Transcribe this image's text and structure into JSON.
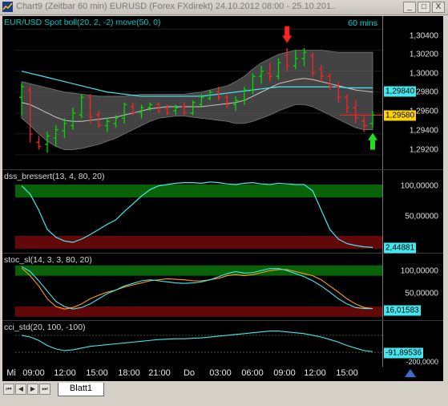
{
  "window": {
    "title": "Chart9 (Zeitbar 60 min)  EURUSD (Forex FXdirekt) 24.10.2012 08:00 - 25.10.201...",
    "buttons": [
      "_",
      "□",
      "X"
    ]
  },
  "price_pane": {
    "label": "EUR/USD Spot boll(20, 2, -2) move(50, 0)",
    "timeframe": "60 mins",
    "ticks": [
      "1,30400",
      "1,30200",
      "1,30000",
      "1,29800",
      "1,29600",
      "1,29400",
      "1,29200"
    ],
    "value_boxes": [
      "1,29840",
      "1,29580"
    ]
  },
  "dss_pane": {
    "label": "dss_bressert(13, 4, 80, 20)",
    "ticks": [
      "100,00000",
      "50,00000"
    ],
    "value_box": "2,44881"
  },
  "stoc_pane": {
    "label": "stoc_sl(14, 3, 3, 80, 20)",
    "ticks": [
      "100,00000",
      "50,00000"
    ],
    "value_box": "16,01583"
  },
  "cci_pane": {
    "label": "cci_std(20, 100, -100)",
    "value_box": "-91,89536",
    "tick": "-200,0000"
  },
  "time_axis": {
    "labels": [
      "Mi",
      "09:00",
      "12:00",
      "15:00",
      "18:00",
      "21:00",
      "Do",
      "03:00",
      "06:00",
      "09:00",
      "12:00",
      "15:00"
    ]
  },
  "tabs": {
    "sheet": "Blatt1",
    "nav": [
      "⏮",
      "◀",
      "▶",
      "⏭"
    ]
  },
  "colors": {
    "up": "#00dd00",
    "down": "#ff2020",
    "band": "#5a5a5a",
    "cyan": "#44e8f0",
    "ma": "#c8c8c8",
    "green_zone": "#0a7a0a",
    "red_zone": "#7a0a0a"
  },
  "chart_data": {
    "type": "candlestick",
    "price": {
      "ylim": [
        1.291,
        1.3045
      ],
      "candles": [
        {
          "o": 1.2975,
          "h": 1.2988,
          "l": 1.2958,
          "c": 1.2985
        },
        {
          "o": 1.2982,
          "h": 1.2985,
          "l": 1.2932,
          "c": 1.294
        },
        {
          "o": 1.2932,
          "h": 1.2938,
          "l": 1.2925,
          "c": 1.2928
        },
        {
          "o": 1.293,
          "h": 1.2942,
          "l": 1.2922,
          "c": 1.2938
        },
        {
          "o": 1.2936,
          "h": 1.2948,
          "l": 1.2928,
          "c": 1.2944
        },
        {
          "o": 1.2943,
          "h": 1.2955,
          "l": 1.2936,
          "c": 1.295
        },
        {
          "o": 1.2948,
          "h": 1.2965,
          "l": 1.2944,
          "c": 1.296
        },
        {
          "o": 1.2958,
          "h": 1.2978,
          "l": 1.2955,
          "c": 1.2975
        },
        {
          "o": 1.2975,
          "h": 1.2978,
          "l": 1.295,
          "c": 1.2956
        },
        {
          "o": 1.2958,
          "h": 1.2962,
          "l": 1.2946,
          "c": 1.2948
        },
        {
          "o": 1.2948,
          "h": 1.2956,
          "l": 1.2942,
          "c": 1.2952
        },
        {
          "o": 1.295,
          "h": 1.2958,
          "l": 1.2946,
          "c": 1.2955
        },
        {
          "o": 1.2955,
          "h": 1.297,
          "l": 1.295,
          "c": 1.2968
        },
        {
          "o": 1.2966,
          "h": 1.297,
          "l": 1.2958,
          "c": 1.296
        },
        {
          "o": 1.296,
          "h": 1.2968,
          "l": 1.2955,
          "c": 1.2965
        },
        {
          "o": 1.2965,
          "h": 1.297,
          "l": 1.2962,
          "c": 1.2968
        },
        {
          "o": 1.2968,
          "h": 1.297,
          "l": 1.296,
          "c": 1.2962
        },
        {
          "o": 1.2964,
          "h": 1.2968,
          "l": 1.2958,
          "c": 1.296
        },
        {
          "o": 1.2962,
          "h": 1.2968,
          "l": 1.2958,
          "c": 1.2965
        },
        {
          "o": 1.2966,
          "h": 1.297,
          "l": 1.2958,
          "c": 1.296
        },
        {
          "o": 1.296,
          "h": 1.2972,
          "l": 1.2958,
          "c": 1.297
        },
        {
          "o": 1.2968,
          "h": 1.2978,
          "l": 1.2966,
          "c": 1.2975
        },
        {
          "o": 1.2974,
          "h": 1.2982,
          "l": 1.2972,
          "c": 1.298
        },
        {
          "o": 1.298,
          "h": 1.2985,
          "l": 1.2972,
          "c": 1.2975
        },
        {
          "o": 1.2975,
          "h": 1.2978,
          "l": 1.2965,
          "c": 1.2968
        },
        {
          "o": 1.2968,
          "h": 1.2976,
          "l": 1.2962,
          "c": 1.2972
        },
        {
          "o": 1.2972,
          "h": 1.2985,
          "l": 1.2968,
          "c": 1.2982
        },
        {
          "o": 1.2982,
          "h": 1.2998,
          "l": 1.2978,
          "c": 1.2995
        },
        {
          "o": 1.2995,
          "h": 1.3005,
          "l": 1.2988,
          "c": 1.3
        },
        {
          "o": 1.2998,
          "h": 1.3008,
          "l": 1.299,
          "c": 1.2995
        },
        {
          "o": 1.2995,
          "h": 1.3012,
          "l": 1.2992,
          "c": 1.3008
        },
        {
          "o": 1.3015,
          "h": 1.3022,
          "l": 1.3,
          "c": 1.3005
        },
        {
          "o": 1.3005,
          "h": 1.302,
          "l": 1.3002,
          "c": 1.3012
        },
        {
          "o": 1.3012,
          "h": 1.3022,
          "l": 1.3005,
          "c": 1.3018
        },
        {
          "o": 1.3015,
          "h": 1.3018,
          "l": 1.2995,
          "c": 1.2998
        },
        {
          "o": 1.3002,
          "h": 1.3006,
          "l": 1.299,
          "c": 1.2995
        },
        {
          "o": 1.2995,
          "h": 1.2998,
          "l": 1.2982,
          "c": 1.2985
        },
        {
          "o": 1.2985,
          "h": 1.299,
          "l": 1.297,
          "c": 1.2975
        },
        {
          "o": 1.2975,
          "h": 1.2978,
          "l": 1.296,
          "c": 1.2965
        },
        {
          "o": 1.2965,
          "h": 1.2972,
          "l": 1.295,
          "c": 1.2955
        },
        {
          "o": 1.2952,
          "h": 1.2958,
          "l": 1.2942,
          "c": 1.2948
        },
        {
          "o": 1.295,
          "h": 1.2962,
          "l": 1.2946,
          "c": 1.2958
        }
      ],
      "upper_band": [
        1.299,
        1.2988,
        1.2986,
        1.2984,
        1.2982,
        1.298,
        1.2979,
        1.2978,
        1.2977,
        1.2976,
        1.2976,
        1.2976,
        1.2976,
        1.2977,
        1.2978,
        1.2978,
        1.2978,
        1.2978,
        1.2978,
        1.2978,
        1.2979,
        1.298,
        1.2982,
        1.2984,
        1.2986,
        1.299,
        1.2995,
        1.3002,
        1.3008,
        1.3012,
        1.3016,
        1.3018,
        1.302,
        1.302,
        1.302,
        1.302,
        1.3019,
        1.3018,
        1.3018,
        1.3018,
        1.3018,
        1.3018
      ],
      "lower_band": [
        1.2955,
        1.2948,
        1.294,
        1.2933,
        1.2928,
        1.2925,
        1.2925,
        1.2926,
        1.2928,
        1.293,
        1.2933,
        1.2936,
        1.294,
        1.2944,
        1.2948,
        1.2952,
        1.2955,
        1.2956,
        1.2957,
        1.2957,
        1.2956,
        1.2955,
        1.2954,
        1.2953,
        1.2952,
        1.295,
        1.295,
        1.2952,
        1.2955,
        1.2958,
        1.2962,
        1.2965,
        1.2968,
        1.2968,
        1.2966,
        1.2962,
        1.2958,
        1.2954,
        1.295,
        1.2946,
        1.2944,
        1.2944
      ],
      "middle_band": [
        1.297,
        1.2968,
        1.2964,
        1.296,
        1.2956,
        1.2953,
        1.2952,
        1.2952,
        1.2953,
        1.2954,
        1.2955,
        1.2956,
        1.2958,
        1.296,
        1.2962,
        1.2964,
        1.2965,
        1.2966,
        1.2966,
        1.2966,
        1.2966,
        1.2966,
        1.2967,
        1.2968,
        1.2969,
        1.297,
        1.2972,
        1.2976,
        1.298,
        1.2984,
        1.2988,
        1.299,
        1.2992,
        1.2993,
        1.2992,
        1.299,
        1.2988,
        1.2986,
        1.2984,
        1.2982,
        1.2981,
        1.298
      ],
      "ma50": [
        1.3,
        1.2998,
        1.2996,
        1.2994,
        1.2992,
        1.299,
        1.2988,
        1.2986,
        1.2984,
        1.2982,
        1.298,
        1.2979,
        1.2978,
        1.2977,
        1.2976,
        1.2976,
        1.2976,
        1.2976,
        1.2976,
        1.2976,
        1.2976,
        1.2976,
        1.2977,
        1.2978,
        1.2979,
        1.298,
        1.2981,
        1.2982,
        1.2983,
        1.2984,
        1.2985,
        1.2985,
        1.2985,
        1.2985,
        1.2985,
        1.2985,
        1.2985,
        1.2985,
        1.2984,
        1.2984,
        1.2984,
        1.2984
      ],
      "hline": 1.2958
    },
    "dss": {
      "ylim": [
        -5,
        120
      ],
      "values": [
        98,
        85,
        60,
        30,
        18,
        12,
        10,
        15,
        22,
        30,
        38,
        45,
        58,
        70,
        82,
        92,
        98,
        100,
        102,
        103,
        103,
        102,
        104,
        103,
        101,
        100,
        102,
        103,
        101,
        100,
        102,
        101,
        100,
        100,
        90,
        60,
        30,
        15,
        8,
        5,
        3,
        2
      ],
      "zones": [
        80,
        20
      ]
    },
    "stoc": {
      "ylim": [
        -5,
        120
      ],
      "series": [
        {
          "values": [
            95,
            80,
            60,
            35,
            20,
            15,
            18,
            25,
            35,
            42,
            48,
            52,
            58,
            62,
            66,
            70,
            72,
            74,
            73,
            72,
            70,
            70,
            72,
            75,
            80,
            82,
            80,
            82,
            86,
            90,
            92,
            92,
            88,
            84,
            80,
            72,
            60,
            48,
            35,
            25,
            18,
            16
          ]
        },
        {
          "values": [
            98,
            88,
            70,
            50,
            30,
            20,
            15,
            18,
            25,
            35,
            45,
            52,
            60,
            65,
            70,
            72,
            70,
            68,
            66,
            65,
            66,
            68,
            72,
            78,
            84,
            88,
            85,
            86,
            90,
            94,
            94,
            90,
            84,
            78,
            70,
            60,
            48,
            35,
            25,
            18,
            16,
            16
          ]
        }
      ],
      "zones": [
        80,
        20
      ]
    },
    "cci": {
      "ylim": [
        -250,
        250
      ],
      "values": [
        100,
        80,
        40,
        -20,
        -60,
        -80,
        -70,
        -50,
        -30,
        -20,
        -10,
        0,
        10,
        20,
        30,
        40,
        50,
        55,
        60,
        60,
        65,
        70,
        80,
        90,
        100,
        110,
        120,
        130,
        140,
        150,
        150,
        140,
        130,
        120,
        100,
        80,
        50,
        20,
        -20,
        -50,
        -80,
        -92
      ]
    }
  }
}
